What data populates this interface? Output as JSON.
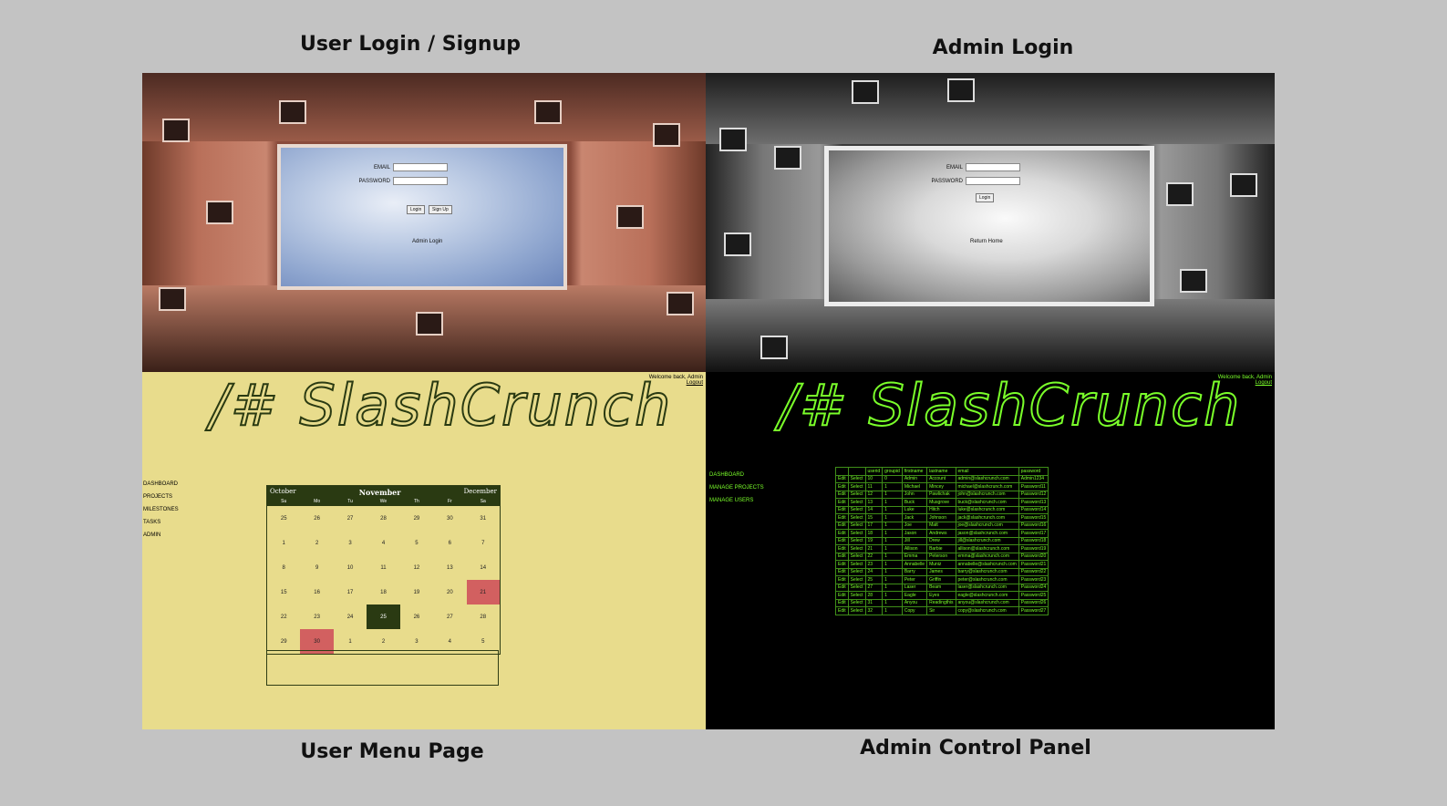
{
  "captions": {
    "user_login": "User Login / Signup",
    "admin_login": "Admin Login",
    "user_menu": "User Menu Page",
    "admin_panel": "Admin Control Panel"
  },
  "user_login": {
    "email_label": "EMAIL",
    "password_label": "PASSWORD",
    "login_button": "Login",
    "signup_button": "Sign Up",
    "admin_link": "Admin Login"
  },
  "admin_login": {
    "email_label": "EMAIL",
    "password_label": "PASSWORD",
    "login_button": "Login",
    "return_link": "Return Home"
  },
  "logo": "/# SlashCrunch",
  "header": {
    "welcome": "Welcome back, Admin",
    "logout": "Logout"
  },
  "user_nav": [
    "DASHBOARD",
    "PROJECTS",
    "MILESTONES",
    "TASKS",
    "ADMIN"
  ],
  "calendar": {
    "prev_month": "October",
    "month": "November",
    "next_month": "December",
    "weekdays": [
      "Su",
      "Mo",
      "Tu",
      "We",
      "Th",
      "Fr",
      "Sa"
    ],
    "days": [
      "25",
      "26",
      "27",
      "28",
      "29",
      "30",
      "31",
      "1",
      "2",
      "3",
      "4",
      "5",
      "6",
      "7",
      "8",
      "9",
      "10",
      "11",
      "12",
      "13",
      "14",
      "15",
      "16",
      "17",
      "18",
      "19",
      "20",
      "21",
      "22",
      "23",
      "24",
      "25",
      "26",
      "27",
      "28",
      "29",
      "30",
      "1",
      "2",
      "3",
      "4",
      "5"
    ],
    "highlighted_red": [
      "21",
      "30"
    ],
    "selected": "25"
  },
  "admin_nav": [
    "DASHBOARD",
    "MANAGE PROJECTS",
    "MANAGE USERS"
  ],
  "colors": {
    "user_bg": "#e8dc8c",
    "calendar_header": "#2a3a12",
    "highlight_red": "#d26060",
    "admin_green": "#7aff2a"
  },
  "users_table": {
    "columns": [
      "",
      "",
      "userid",
      "groupid",
      "firstname",
      "lastname",
      "email",
      "password"
    ],
    "rows": [
      [
        "Edit",
        "Select",
        "10",
        "0",
        "Admin",
        "Account",
        "admin@slashcrunch.com",
        "Admin1234"
      ],
      [
        "Edit",
        "Select",
        "11",
        "1",
        "Michael",
        "Mincey",
        "michael@slashcrunch.com",
        "Password11"
      ],
      [
        "Edit",
        "Select",
        "12",
        "1",
        "John",
        "Pawlichak",
        "john@slashcrunch.com",
        "Password12"
      ],
      [
        "Edit",
        "Select",
        "13",
        "1",
        "Buck",
        "Musgrove",
        "buck@slashcrunch.com",
        "Password13"
      ],
      [
        "Edit",
        "Select",
        "14",
        "1",
        "Luke",
        "Hitch",
        "luke@slashcrunch.com",
        "Password14"
      ],
      [
        "Edit",
        "Select",
        "15",
        "1",
        "Jack",
        "Johnson",
        "jack@slashcrunch.com",
        "Password15"
      ],
      [
        "Edit",
        "Select",
        "17",
        "1",
        "Joe",
        "Matt",
        "joe@slashcrunch.com",
        "Password16"
      ],
      [
        "Edit",
        "Select",
        "18",
        "1",
        "Jason",
        "Andrews",
        "jason@slashcrunch.com",
        "Password17"
      ],
      [
        "Edit",
        "Select",
        "19",
        "1",
        "Jill",
        "Drew",
        "jill@slashcrunch.com",
        "Password18"
      ],
      [
        "Edit",
        "Select",
        "21",
        "1",
        "Allison",
        "Barbie",
        "allison@slashcrunch.com",
        "Password19"
      ],
      [
        "Edit",
        "Select",
        "22",
        "1",
        "Emma",
        "Peterson",
        "emma@slashcrunch.com",
        "Password20"
      ],
      [
        "Edit",
        "Select",
        "23",
        "1",
        "Annabelle",
        "Muniz",
        "annabelle@slashcrunch.com",
        "Password21"
      ],
      [
        "Edit",
        "Select",
        "24",
        "1",
        "Barry",
        "James",
        "barry@slashcrunch.com",
        "Password22"
      ],
      [
        "Edit",
        "Select",
        "25",
        "1",
        "Peter",
        "Griffin",
        "peter@slashcrunch.com",
        "Password23"
      ],
      [
        "Edit",
        "Select",
        "27",
        "1",
        "Laser",
        "Beam",
        "laser@slashcrunch.com",
        "Password24"
      ],
      [
        "Edit",
        "Select",
        "28",
        "1",
        "Eagle",
        "Eyes",
        "eagle@slashcrunch.com",
        "Password25"
      ],
      [
        "Edit",
        "Select",
        "31",
        "1",
        "Anyou",
        "Readingthis",
        "anyou@slashcrunch.com",
        "Password26"
      ],
      [
        "Edit",
        "Select",
        "32",
        "1",
        "Copy",
        "Sir",
        "copy@slashcrunch.com",
        "Password27"
      ]
    ]
  }
}
